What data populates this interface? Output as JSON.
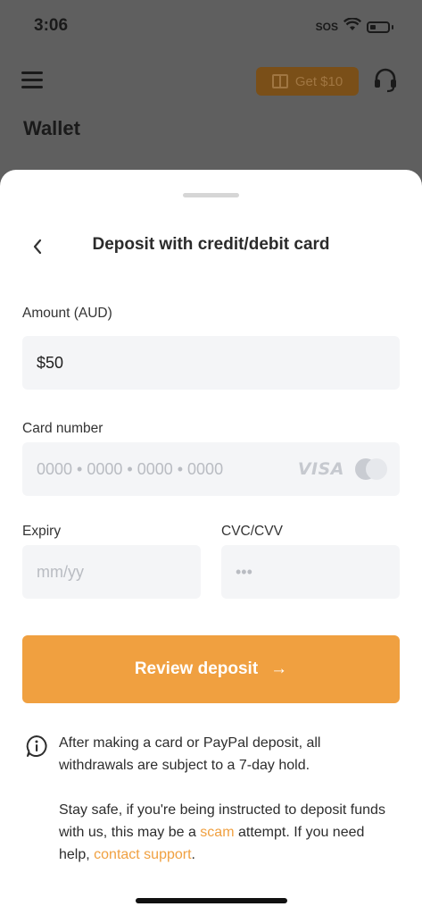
{
  "status_bar": {
    "time": "3:06",
    "sos": "SOS"
  },
  "background": {
    "promo_label": "Get $10",
    "page_title": "Wallet"
  },
  "sheet": {
    "title": "Deposit with credit/debit card",
    "amount": {
      "label": "Amount (AUD)",
      "value": "$50"
    },
    "card_number": {
      "label": "Card number",
      "placeholder": "0000 • 0000 • 0000 • 0000",
      "brand_visa": "VISA"
    },
    "expiry": {
      "label": "Expiry",
      "placeholder": "mm/yy"
    },
    "cvc": {
      "label": "CVC/CVV",
      "placeholder": "•••"
    },
    "review_button": {
      "label": "Review deposit",
      "arrow": "→"
    },
    "notice": {
      "p1": "After making a card or PayPal deposit, all withdrawals are subject to a 7-day hold.",
      "p2_part1": "Stay safe, if you're being instructed to deposit funds with us, this may be a ",
      "p2_link1": "scam",
      "p2_part2": " attempt. If you need help, ",
      "p2_link2": "contact support",
      "p2_part3": "."
    }
  },
  "colors": {
    "accent": "#f0a040",
    "field_bg": "#f4f5f7",
    "overlay": "#5f5f5f"
  }
}
